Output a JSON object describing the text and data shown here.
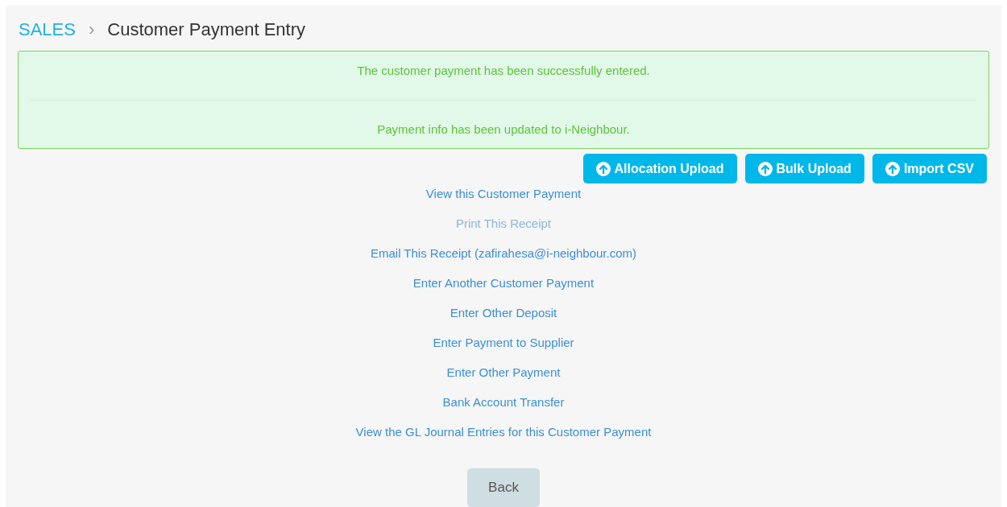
{
  "breadcrumb": {
    "section": "SALES",
    "separator": "›",
    "page": "Customer Payment Entry"
  },
  "alert": {
    "messages": [
      "The customer payment has been successfully entered.",
      "Payment info has been updated to i-Neighbour."
    ]
  },
  "actions": [
    "Allocation Upload",
    "Bulk Upload",
    "Import CSV"
  ],
  "links": [
    {
      "label": "View this Customer Payment",
      "visited": false
    },
    {
      "label": "Print This Receipt",
      "visited": true
    },
    {
      "label": "Email This Receipt (zafirahesa@i-neighbour.com)",
      "visited": false
    },
    {
      "label": "Enter Another Customer Payment",
      "visited": false
    },
    {
      "label": "Enter Other Deposit",
      "visited": false
    },
    {
      "label": "Enter Payment to Supplier",
      "visited": false
    },
    {
      "label": "Enter Other Payment",
      "visited": false
    },
    {
      "label": "Bank Account Transfer",
      "visited": false
    },
    {
      "label": "View the GL Journal Entries for this Customer Payment",
      "visited": false
    }
  ],
  "back_button": "Back"
}
